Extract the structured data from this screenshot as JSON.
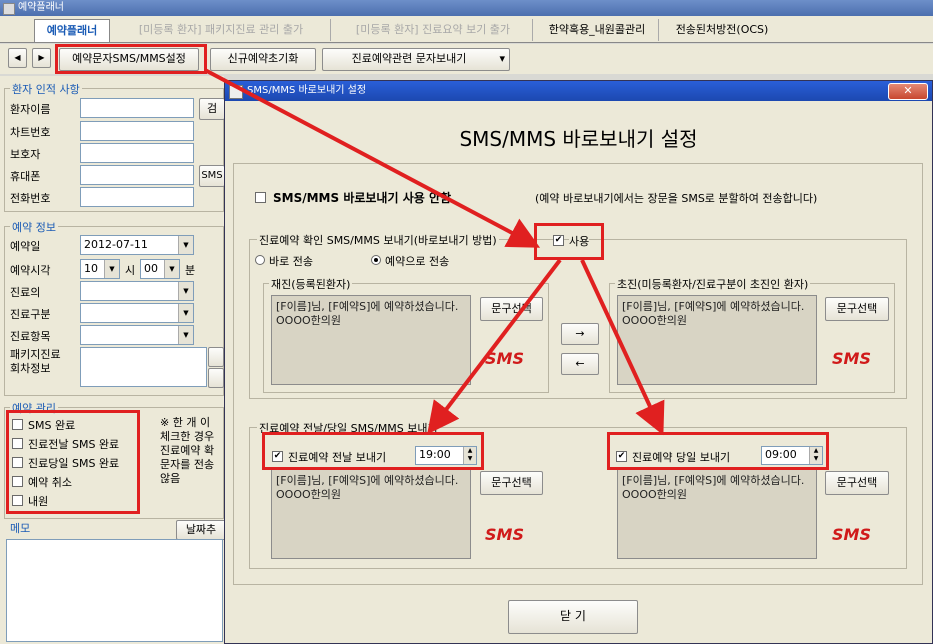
{
  "app": {
    "title": "예약플래너"
  },
  "tabs": [
    {
      "label": "예약플래너"
    },
    {
      "label": "[미등록 환자] 패키지진료 관리 출가"
    },
    {
      "label": "[미등록 환자] 진료요약 보기 출가"
    },
    {
      "label": "한약혹용_내원콜관리"
    },
    {
      "label": "전송된처방전(OCS)"
    }
  ],
  "toolbar": {
    "prev": "◀",
    "next": "▶",
    "sms_settings": "예약문자SMS/MMS설정",
    "reset": "신규예약초기화",
    "send_menu": "진료예약관련 문자보내기",
    "send_arrow": "▾"
  },
  "patient": {
    "title": "환자 인적 사항",
    "name": "환자이름",
    "search": "검",
    "chart": "차트번호",
    "guardian": "보호자",
    "mobile": "휴대폰",
    "sms": "SMS",
    "phone": "전화번호"
  },
  "reservation": {
    "title": "예약 정보",
    "date_label": "예약일",
    "date_value": "2012-07-11",
    "time_label": "예약시각",
    "hour": "10",
    "hour_unit": "시",
    "minute": "00",
    "minute_unit": "분",
    "doctor": "진료의",
    "category": "진료구분",
    "item": "진료항목",
    "package": "패키지진료\n회차정보"
  },
  "manage": {
    "title": "예약 관리",
    "items": [
      "SMS 완료",
      "진료전날 SMS 완료",
      "진료당일 SMS 완료",
      "예약 취소",
      "내원"
    ],
    "note": "※ 한 개 이\n체크한 경우\n진료예약 확\n문자를 전송\n않음"
  },
  "memo": {
    "title": "메모",
    "date_btn": "날짜추"
  },
  "dialog": {
    "title": "SMS/MMS 바로보내기 설정",
    "close": "✕",
    "heading": "SMS/MMS 바로보내기 설정",
    "disable_label": "SMS/MMS 바로보내기 사용 안함",
    "disable_note": "(예약 바로보내기에서는 장문을 SMS로 분할하여 전송합니다)",
    "confirm_group": "진료예약 확인 SMS/MMS 보내기(바로보내기 방법)",
    "use_label": "사용",
    "radio_direct": "바로 전송",
    "radio_reserve": "예약으로 전송",
    "revisit_label": "재진(등록된환자)",
    "first_label": "초진(미등록환자/진료구분이 초진인 환자)",
    "message": "[F이름]님, [F예약S]에 예약하셨습니다. OOOO한의원",
    "select_btn": "문구선택",
    "sms_badge": "SMS",
    "copy_right": "→",
    "copy_left": "←",
    "daybefore_group": "진료예약 전날/당일 SMS/MMS 보내기",
    "daybefore_label": "진료예약 전날 보내기",
    "daybefore_time": "19:00",
    "sameday_label": "진료예약 당일 보내기",
    "sameday_time": "09:00",
    "close_btn": "닫 기"
  },
  "colors": {
    "highlight": "#e02020",
    "sms": "#d01a1a",
    "accent": "#1a5bb5"
  }
}
